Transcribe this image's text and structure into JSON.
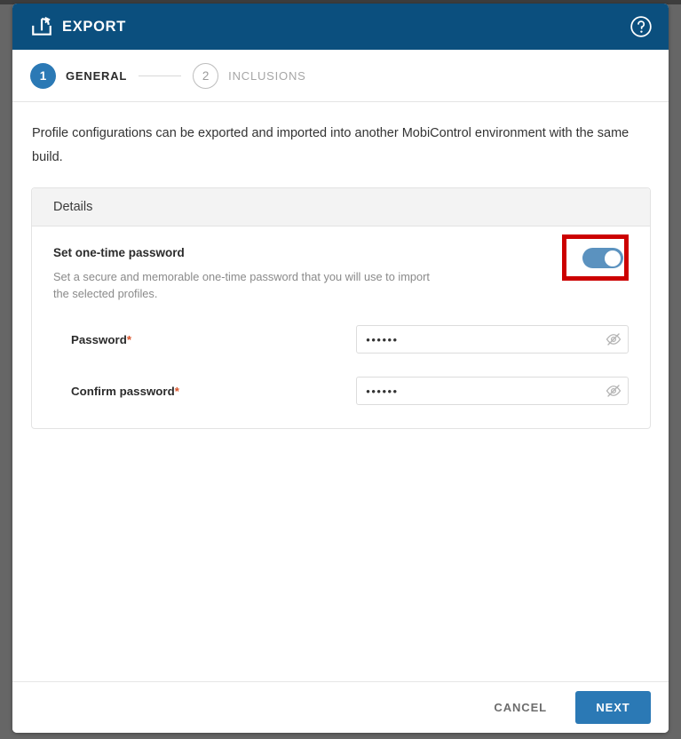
{
  "dialog": {
    "title": "EXPORT",
    "export_icon": "export-share-icon",
    "help_icon": "help-circle-icon"
  },
  "steps": [
    {
      "number": "1",
      "label": "GENERAL",
      "state": "active"
    },
    {
      "number": "2",
      "label": "INCLUSIONS",
      "state": "inactive"
    }
  ],
  "body": {
    "intro": "Profile configurations can be exported and imported into another MobiControl environment with the same build.",
    "card": {
      "header": "Details",
      "toggle": {
        "title": "Set one-time password",
        "description": "Set a secure and memorable one-time password that you will use to import the selected profiles.",
        "state": "on",
        "annotation": "red-highlight-box"
      },
      "fields": [
        {
          "label": "Password",
          "required": "*",
          "value": "••••••",
          "placeholder": "",
          "reveal_icon": "eye-off-icon"
        },
        {
          "label": "Confirm password",
          "required": "*",
          "value": "••••••",
          "placeholder": "",
          "reveal_icon": "eye-off-icon"
        }
      ]
    }
  },
  "footer": {
    "cancel_label": "CANCEL",
    "next_label": "NEXT"
  },
  "colors": {
    "header_blue": "#0b4f7e",
    "accent_blue": "#2b79b5",
    "toggle_on": "#5b92bf",
    "annotation_red": "#cc0000",
    "required_red": "#d9542b",
    "backdrop_gray": "#666666"
  }
}
